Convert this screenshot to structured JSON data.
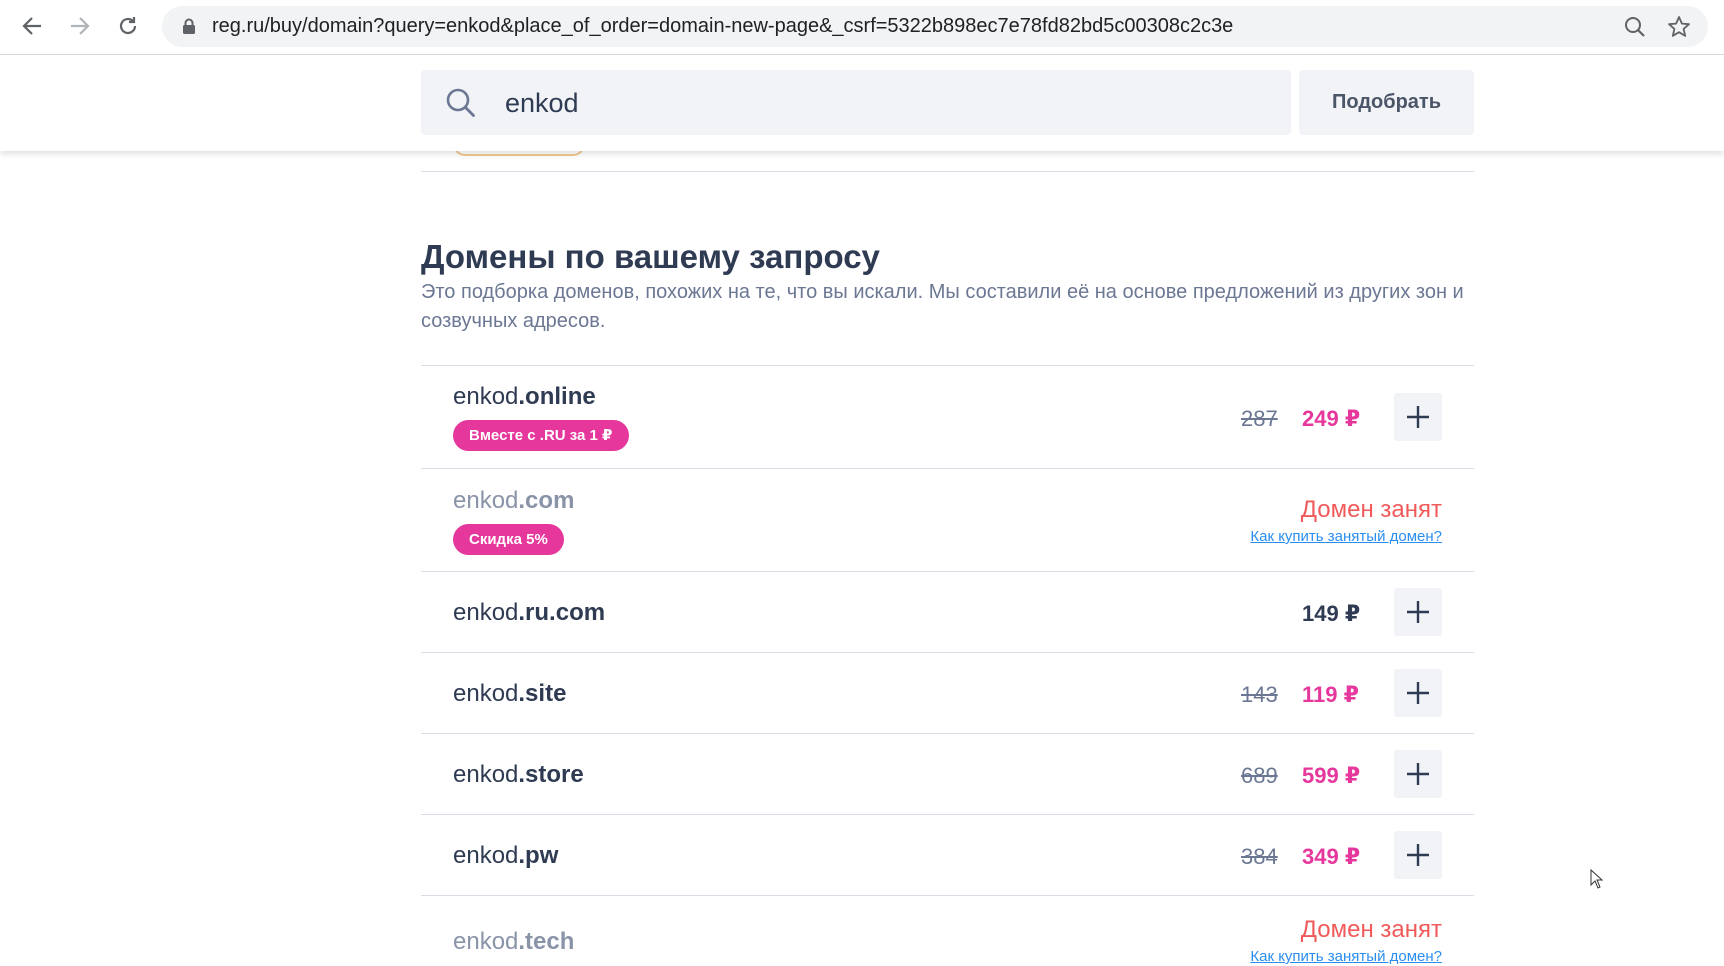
{
  "browser": {
    "url": "reg.ru/buy/domain?query=enkod&place_of_order=domain-new-page&_csrf=5322b898ec7e78fd82bd5c00308c2c3e",
    "icons": [
      "back-icon",
      "forward-icon",
      "reload-icon",
      "lock-icon",
      "zoom-icon",
      "star-icon"
    ]
  },
  "search": {
    "query": "enkod",
    "button_label": "Подобрать"
  },
  "section": {
    "title": "Домены по вашему запросу",
    "description": "Это подборка доменов, похожих на те, что вы искали. Мы составили её на основе предложений из других зон и созвучных адресов."
  },
  "domains": [
    {
      "name": "enkod",
      "zone": ".online",
      "old_price": "287",
      "price": "249 ₽",
      "badge": "Вместе с .RU за 1 ₽",
      "taken": false
    },
    {
      "name": "enkod",
      "zone": ".com",
      "badge": "Скидка 5%",
      "taken": true,
      "status": "Домен занят",
      "link": "Как купить занятый домен?"
    },
    {
      "name": "enkod",
      "zone": ".ru.com",
      "price": "149 ₽",
      "taken": false
    },
    {
      "name": "enkod",
      "zone": ".site",
      "old_price": "143",
      "price": "119 ₽",
      "taken": false
    },
    {
      "name": "enkod",
      "zone": ".store",
      "old_price": "689",
      "price": "599 ₽",
      "taken": false
    },
    {
      "name": "enkod",
      "zone": ".pw",
      "old_price": "384",
      "price": "349 ₽",
      "taken": false
    },
    {
      "name": "enkod",
      "zone": ".tech",
      "taken": true,
      "status": "Домен занят",
      "link": "Как купить занятый домен?"
    }
  ],
  "colors": {
    "accent_pink": "#e6379c",
    "taken_red": "#f05a5a",
    "link_blue": "#2a8ef0",
    "text_dark": "#2f3b52"
  }
}
